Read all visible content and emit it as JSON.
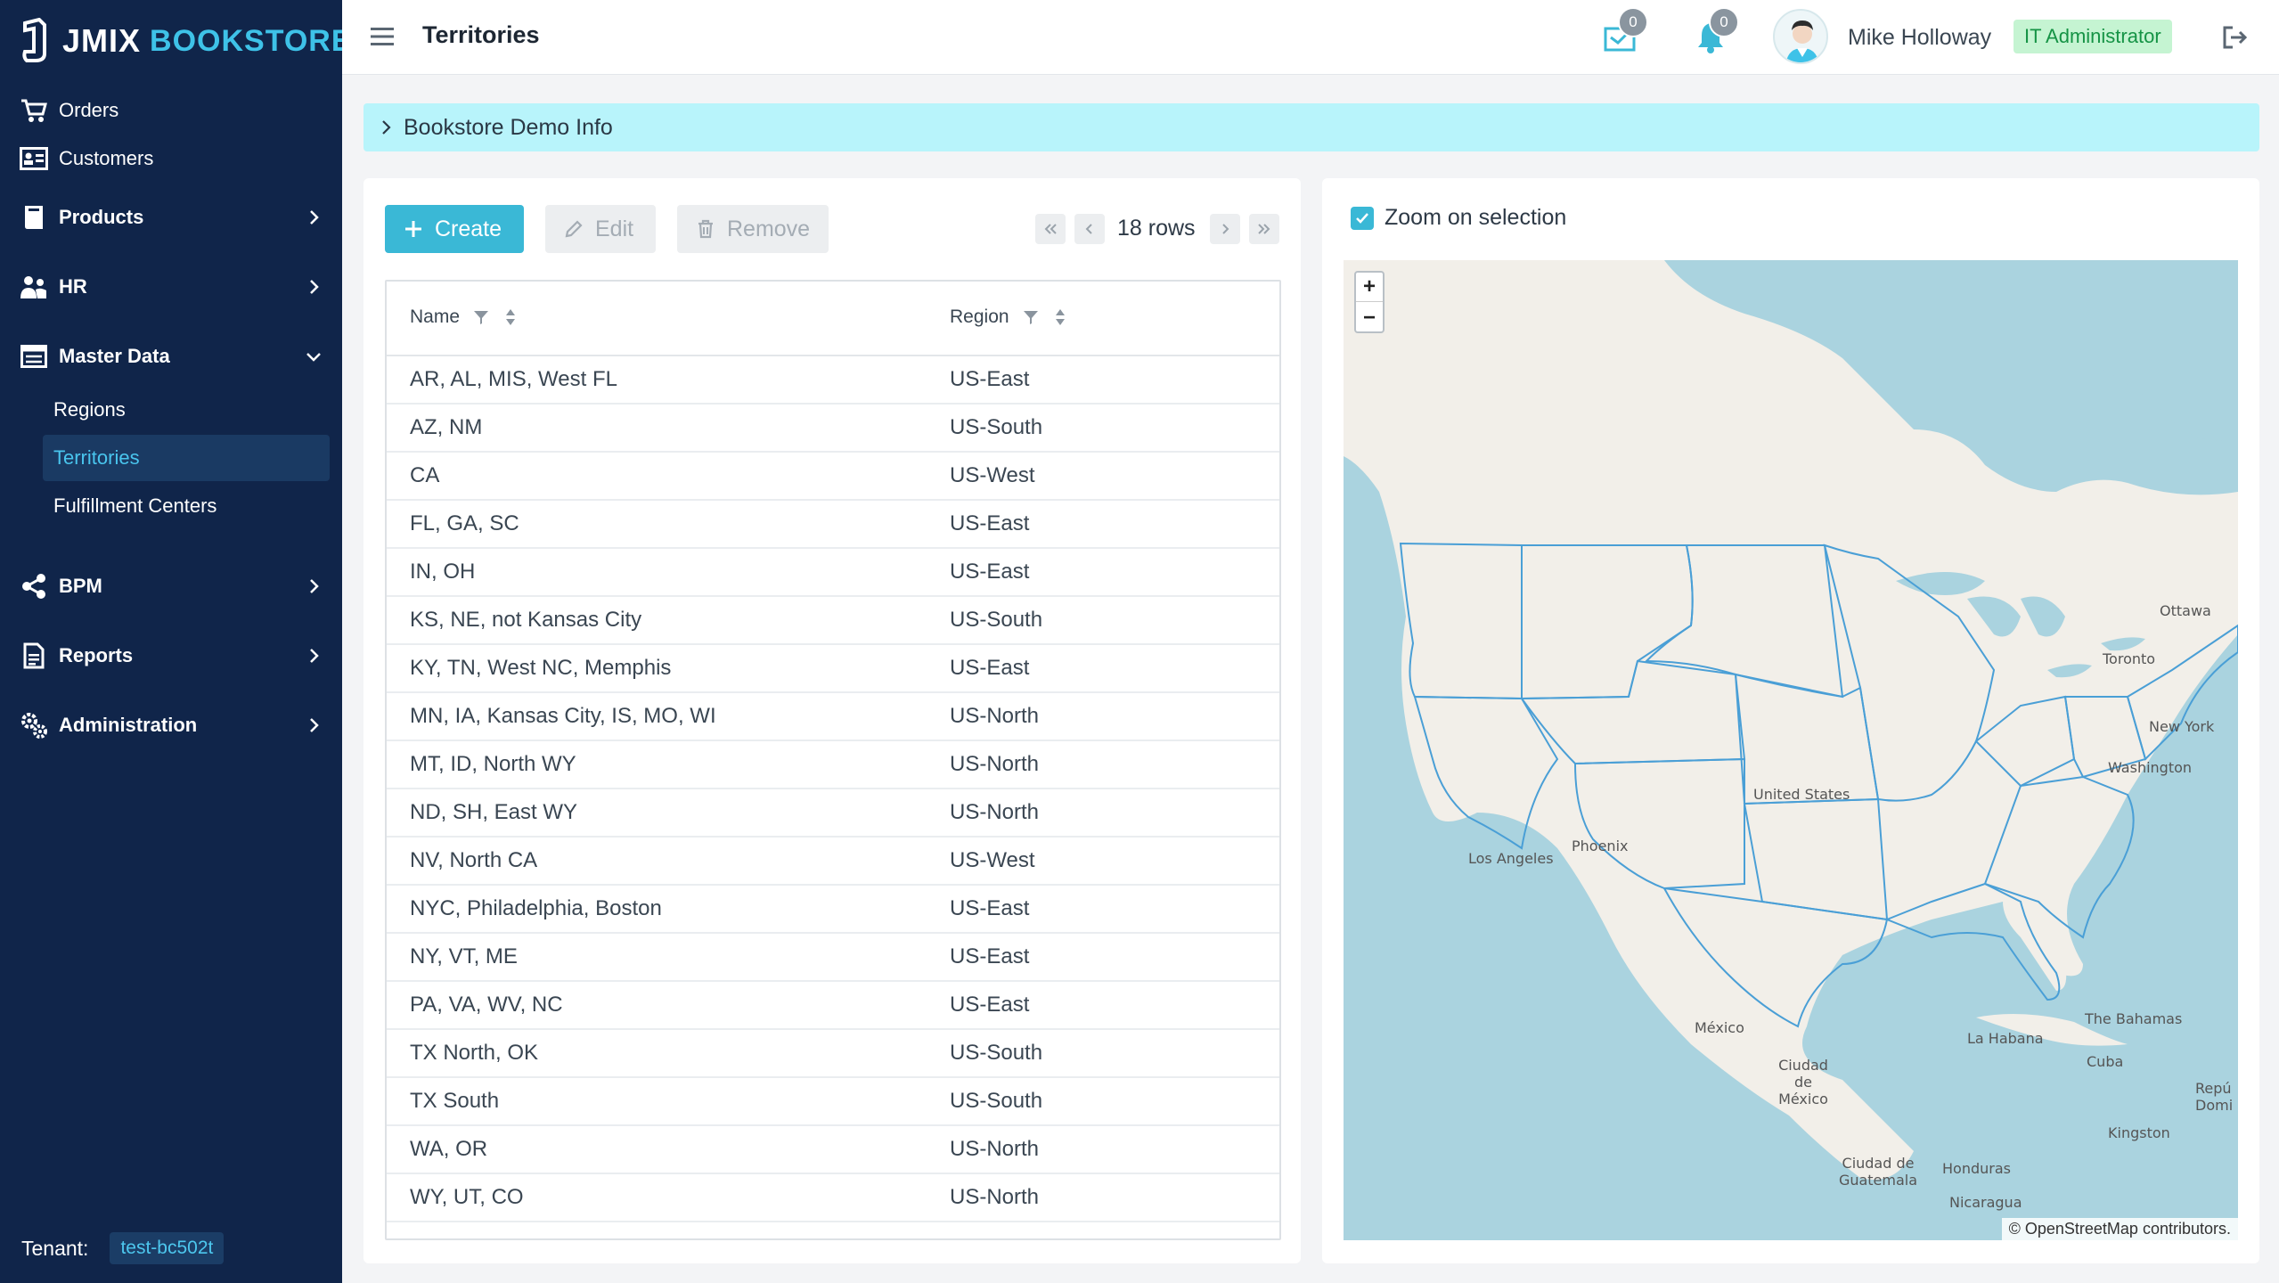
{
  "brand": {
    "name_left": "JMIX",
    "name_right": "BOOKSTORE",
    "accent": "#3ec2e8",
    "sidebar_bg": "#10254a"
  },
  "sidebar": {
    "items": [
      {
        "label": "Orders",
        "icon": "cart-icon"
      },
      {
        "label": "Customers",
        "icon": "id-card-icon"
      },
      {
        "label": "Products",
        "icon": "book-icon",
        "expandable": true
      },
      {
        "label": "HR",
        "icon": "users-icon",
        "expandable": true
      },
      {
        "label": "Master Data",
        "icon": "table-icon",
        "expandable": true,
        "expanded": true,
        "children": [
          "Regions",
          "Territories",
          "Fulfillment Centers"
        ],
        "active_child": "Territories"
      },
      {
        "label": "BPM",
        "icon": "share-icon",
        "expandable": true
      },
      {
        "label": "Reports",
        "icon": "report-icon",
        "expandable": true
      },
      {
        "label": "Administration",
        "icon": "gears-icon",
        "expandable": true
      }
    ],
    "tenant_label": "Tenant:",
    "tenant_value": "test-bc502t"
  },
  "header": {
    "title": "Territories",
    "inbox_count": "0",
    "notification_count": "0",
    "user_name": "Mike Holloway",
    "role": "IT Administrator"
  },
  "info_bar": {
    "title": "Bookstore Demo Info"
  },
  "toolbar": {
    "create_label": "Create",
    "edit_label": "Edit",
    "remove_label": "Remove",
    "rows_count": "18 rows"
  },
  "grid": {
    "columns": [
      "Name",
      "Region"
    ],
    "rows": [
      [
        "AR, AL, MIS, West FL",
        "US-East"
      ],
      [
        "AZ, NM",
        "US-South"
      ],
      [
        "CA",
        "US-West"
      ],
      [
        "FL, GA, SC",
        "US-East"
      ],
      [
        "IN, OH",
        "US-East"
      ],
      [
        "KS, NE, not Kansas City",
        "US-South"
      ],
      [
        "KY, TN, West NC, Memphis",
        "US-East"
      ],
      [
        "MN, IA, Kansas City, IS, MO, WI",
        "US-North"
      ],
      [
        "MT, ID, North WY",
        "US-North"
      ],
      [
        "ND, SH, East WY",
        "US-North"
      ],
      [
        "NV, North CA",
        "US-West"
      ],
      [
        "NYC, Philadelphia, Boston",
        "US-East"
      ],
      [
        "NY, VT, ME",
        "US-East"
      ],
      [
        "PA, VA, WV, NC",
        "US-East"
      ],
      [
        "TX North, OK",
        "US-South"
      ],
      [
        "TX South",
        "US-South"
      ],
      [
        "WA, OR",
        "US-North"
      ],
      [
        "WY, UT, CO",
        "US-North"
      ]
    ]
  },
  "map": {
    "zoom_on_selection_label": "Zoom on selection",
    "zoom_on_selection_checked": true,
    "zoom_in": "+",
    "zoom_out": "−",
    "attribution": "© OpenStreetMap contributors.",
    "labels": [
      "Ottawa",
      "Toronto",
      "New York",
      "Washington",
      "United States",
      "Phoenix",
      "Los Angeles",
      "México",
      "Ciudad de México",
      "La Habana",
      "The Bahamas",
      "Cuba",
      "Kingston",
      "Ciudad de Guatemala",
      "Honduras",
      "Nicaragua",
      "Repú Domi"
    ]
  }
}
